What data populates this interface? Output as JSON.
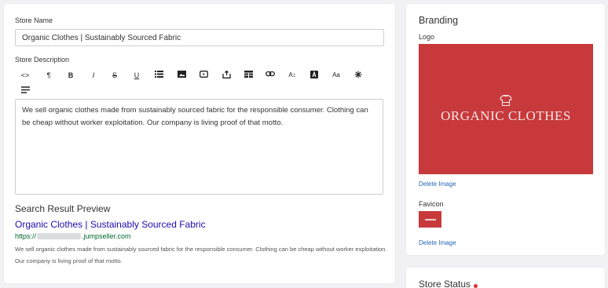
{
  "store": {
    "name_label": "Store Name",
    "name_value": "Organic Clothes | Sustainably Sourced Fabric",
    "description_label": "Store Description",
    "description_value": "We sell organic clothes made from sustainably sourced fabric for the responsible consumer. Clothing can be cheap without worker exploitation. Our company is living proof of that motto."
  },
  "toolbar": {
    "html": "<>",
    "paragraph": "¶",
    "bold": "B",
    "italic": "I",
    "strike": "S",
    "underline": "U",
    "font_size": "A↕",
    "text_style": "Aa",
    "icons": [
      "code-icon",
      "paragraph-icon",
      "bold-icon",
      "italic-icon",
      "strikethrough-icon",
      "underline-icon",
      "list-icon",
      "image-icon",
      "video-icon",
      "file-icon",
      "table-icon",
      "link-icon",
      "font-size-icon",
      "font-color-icon",
      "text-style-icon",
      "special-char-icon",
      "align-icon"
    ]
  },
  "search_preview": {
    "heading": "Search Result Preview",
    "title": "Organic Clothes | Sustainably Sourced Fabric",
    "url_prefix": "https://",
    "url_suffix": ".jumpseller.com",
    "description": "We sell organic clothes made from sustainably sourced fabric for the responsible consumer. Clothing can be cheap without worker exploitation. Our company is living proof of that motto."
  },
  "branding": {
    "title": "Branding",
    "logo_label": "Logo",
    "logo_text": "ORGANIC CLOTHES",
    "delete_logo": "Delete Image",
    "favicon_label": "Favicon",
    "delete_favicon": "Delete Image",
    "brand_color": "#c8393b"
  },
  "status": {
    "title": "Store Status",
    "indicator_color": "#d93237"
  }
}
